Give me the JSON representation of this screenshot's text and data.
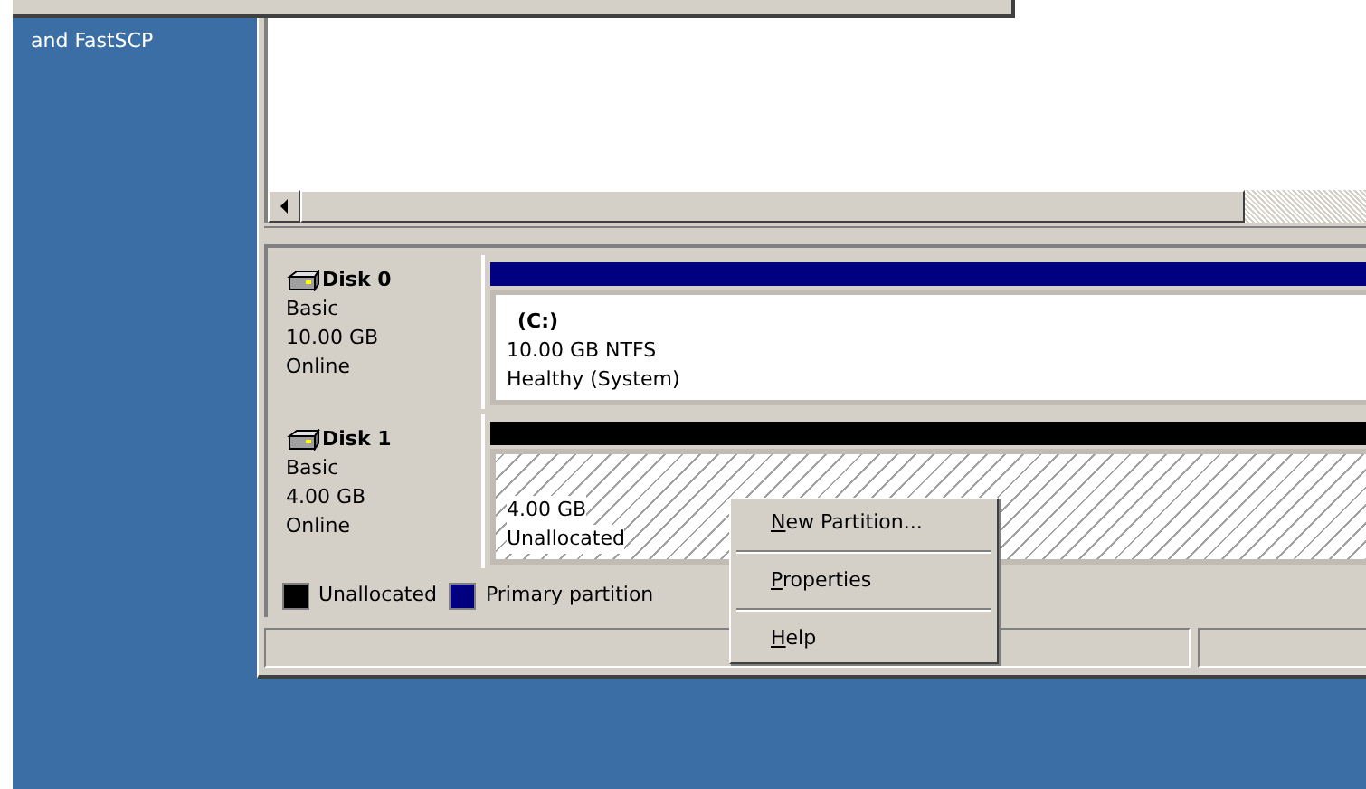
{
  "desktop_icon": {
    "label": "and FastSCP"
  },
  "disks": [
    {
      "name": "Disk 0",
      "type": "Basic",
      "size": "10.00 GB",
      "status": "Online",
      "color": "#000080",
      "partition": {
        "kind": "primary",
        "label": "(C:)",
        "size": "10.00 GB NTFS",
        "status": "Healthy (System)"
      }
    },
    {
      "name": "Disk 1",
      "type": "Basic",
      "size": "4.00 GB",
      "status": "Online",
      "color": "#000000",
      "partition": {
        "kind": "unallocated",
        "size": "4.00 GB",
        "status": "Unallocated"
      }
    }
  ],
  "legend": [
    {
      "label": "Unallocated",
      "color": "#000000"
    },
    {
      "label": "Primary partition",
      "color": "#000080"
    }
  ],
  "context_menu": {
    "items": [
      "New Partition...",
      "Properties",
      "Help"
    ]
  }
}
